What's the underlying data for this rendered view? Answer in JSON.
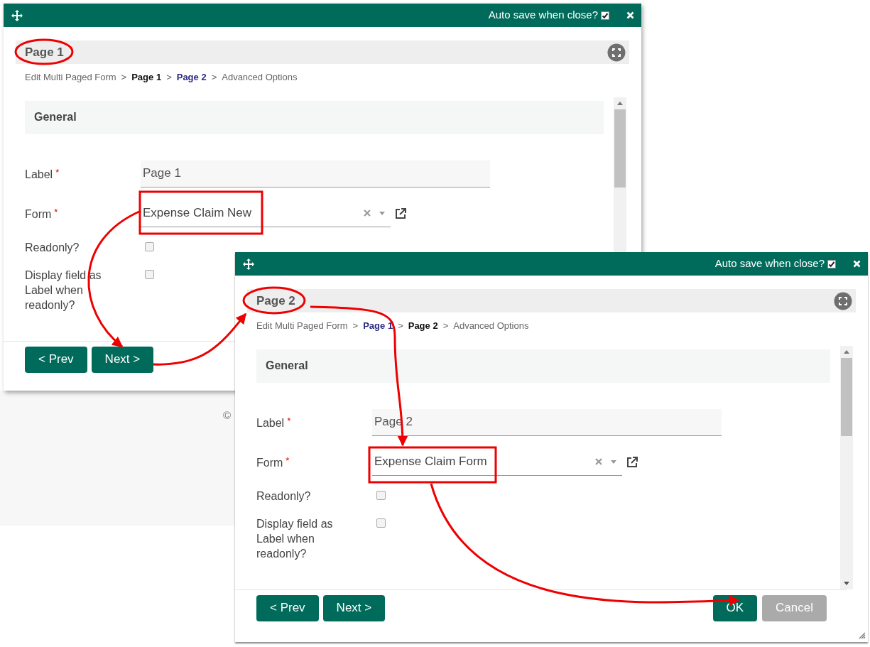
{
  "background": {
    "copyright": "©"
  },
  "dialogs": [
    {
      "autosave_label": "Auto save when close?",
      "autosave_checked": true,
      "title": "Page 1",
      "separator": ">",
      "breadcrumb": [
        {
          "label": "Edit Multi Paged Form",
          "kind": "plain"
        },
        {
          "label": "Page 1",
          "kind": "current"
        },
        {
          "label": "Page 2",
          "kind": "link"
        },
        {
          "label": "Advanced Options",
          "kind": "plain"
        }
      ],
      "section": "General",
      "fields": [
        {
          "kind": "text",
          "label": "Label",
          "required_mark": "*",
          "value": "Page 1"
        },
        {
          "kind": "select",
          "label": "Form",
          "required_mark": "*",
          "value": "Expense Claim New"
        },
        {
          "kind": "checkbox",
          "label": "Readonly?",
          "checked": false
        },
        {
          "kind": "checkbox",
          "label": "Display field as Label when readonly?",
          "checked": false
        }
      ],
      "buttons": [
        {
          "kind": "nav",
          "label": "< Prev",
          "disabled": false
        },
        {
          "kind": "nav",
          "label": "Next >",
          "disabled": false
        }
      ]
    },
    {
      "autosave_label": "Auto save when close?",
      "autosave_checked": true,
      "title": "Page 2",
      "separator": ">",
      "breadcrumb": [
        {
          "label": "Edit Multi Paged Form",
          "kind": "plain"
        },
        {
          "label": "Page 1",
          "kind": "link"
        },
        {
          "label": "Page 2",
          "kind": "current"
        },
        {
          "label": "Advanced Options",
          "kind": "plain"
        }
      ],
      "section": "General",
      "fields": [
        {
          "kind": "text",
          "label": "Label",
          "required_mark": "*",
          "value": "Page 2"
        },
        {
          "kind": "select",
          "label": "Form",
          "required_mark": "*",
          "value": "Expense Claim Form"
        },
        {
          "kind": "checkbox",
          "label": "Readonly?",
          "checked": false
        },
        {
          "kind": "checkbox",
          "label": "Display field as Label when readonly?",
          "checked": false
        }
      ],
      "buttons": [
        {
          "kind": "nav",
          "label": "< Prev",
          "disabled": false
        },
        {
          "kind": "nav",
          "label": "Next >",
          "disabled": false
        },
        {
          "kind": "action",
          "label": "OK",
          "disabled": false
        },
        {
          "kind": "action",
          "label": "Cancel",
          "disabled": true
        }
      ]
    }
  ]
}
